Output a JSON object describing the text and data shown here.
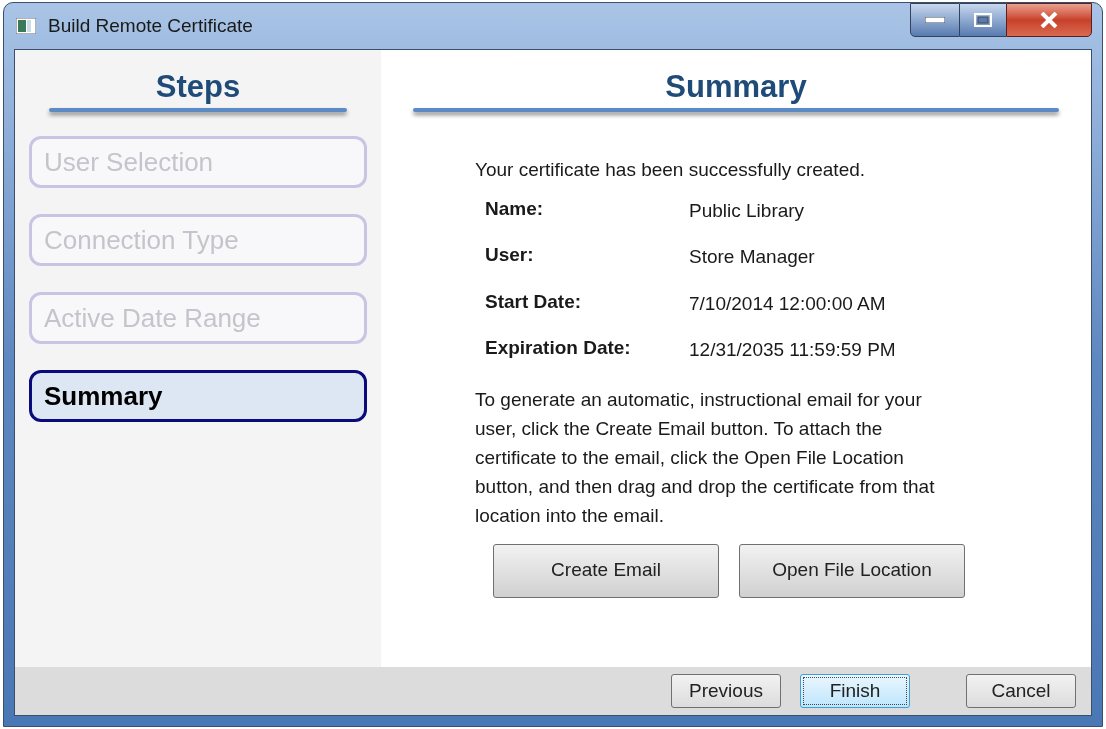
{
  "window": {
    "title": "Build Remote Certificate"
  },
  "steps_panel": {
    "heading": "Steps",
    "items": [
      {
        "label": "User Selection",
        "selected": false
      },
      {
        "label": "Connection Type",
        "selected": false
      },
      {
        "label": "Active Date Range",
        "selected": false
      },
      {
        "label": "Summary",
        "selected": true
      }
    ]
  },
  "summary": {
    "heading": "Summary",
    "intro": "Your certificate has been successfully created.",
    "fields": [
      {
        "label": "Name:",
        "value": "Public Library"
      },
      {
        "label": "User:",
        "value": "Store Manager"
      },
      {
        "label": "Start Date:",
        "value": "7/10/2014 12:00:00 AM"
      },
      {
        "label": "Expiration Date:",
        "value": "12/31/2035 11:59:59 PM"
      }
    ],
    "instructions": "To generate an automatic, instructional email for your user, click the Create Email button. To attach the certificate to the email, click the Open File Location button, and then drag and drop the certificate from that location into the email.",
    "actions": [
      "Create Email",
      "Open File Location"
    ]
  },
  "footer": {
    "buttons": [
      {
        "label": "Previous",
        "focused": false
      },
      {
        "label": "Finish",
        "focused": true
      },
      {
        "label": "Cancel",
        "focused": false
      }
    ]
  }
}
